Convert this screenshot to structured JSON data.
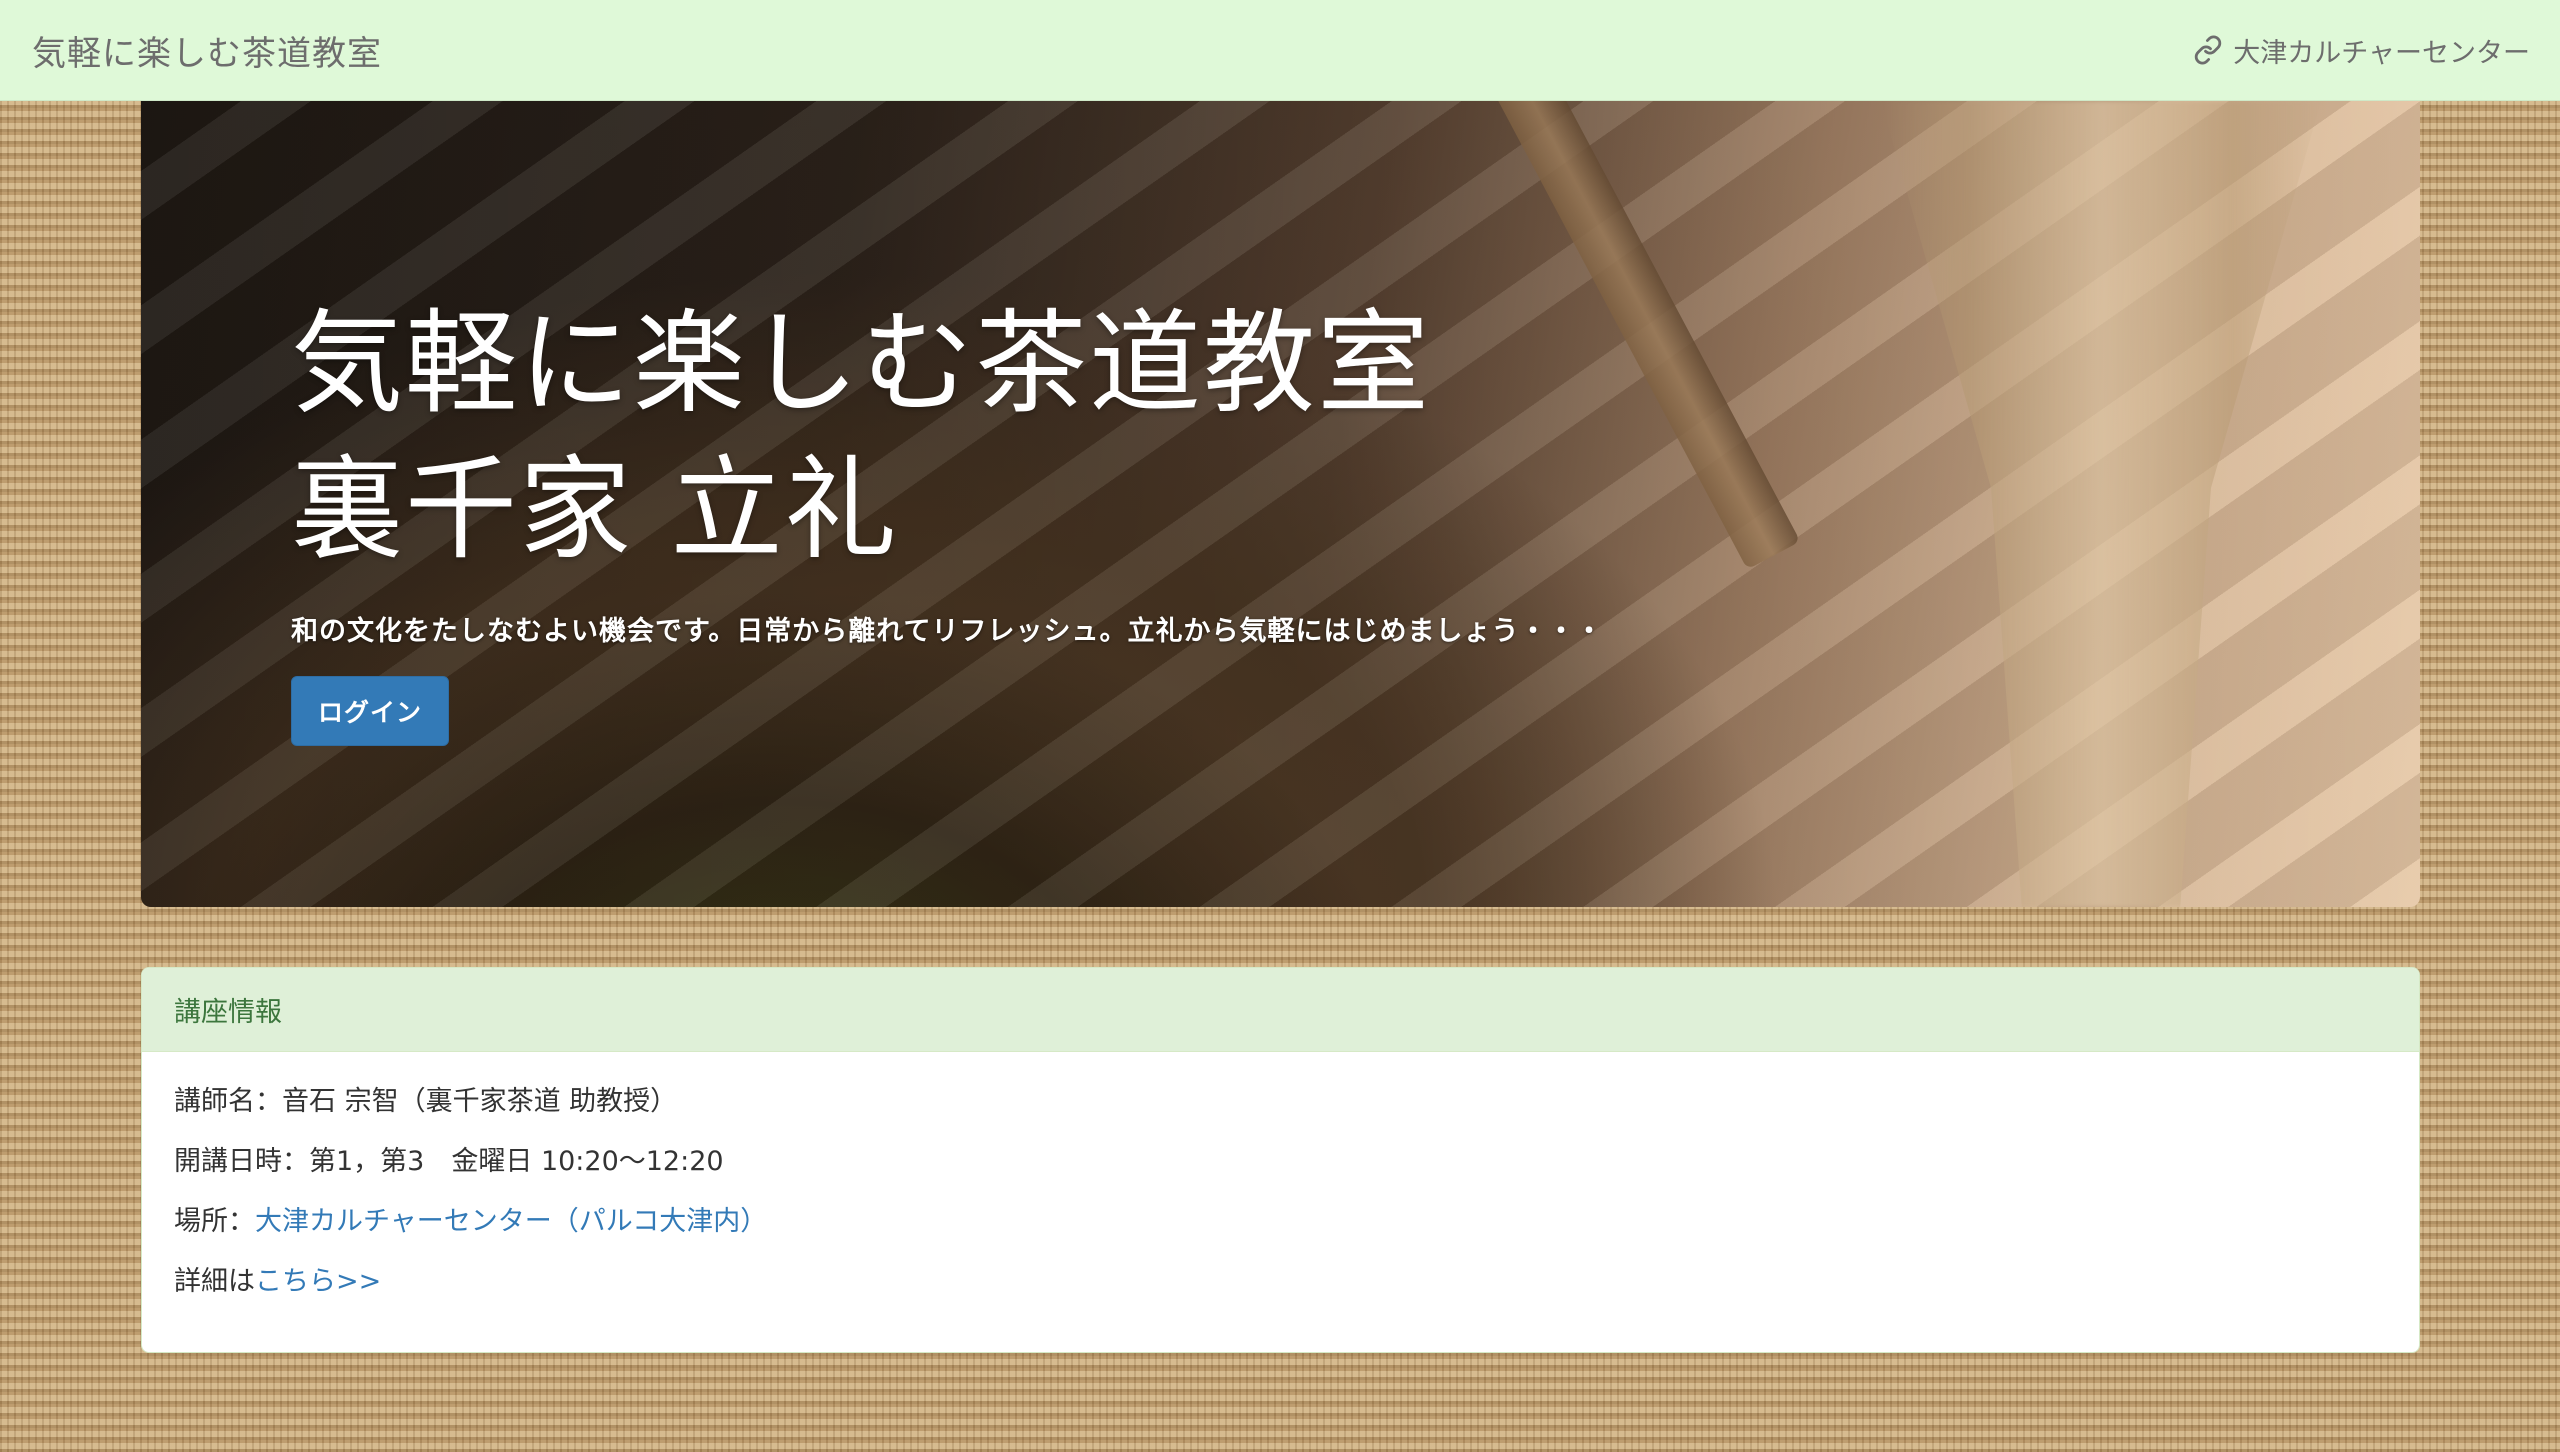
{
  "navbar": {
    "brand": "気軽に楽しむ茶道教室",
    "link_label": "大津カルチャーセンター",
    "link_icon": "link-icon"
  },
  "hero": {
    "title_line1": "気軽に楽しむ茶道教室",
    "title_line2": "裏千家 立礼",
    "lead": "和の文化をたしなむよい機会です。日常から離れてリフレッシュ。立礼から気軽にはじめましょう・・・",
    "login_label": "ログイン"
  },
  "panel": {
    "heading": "講座情報",
    "instructor": "講師名：音石 宗智（裏千家茶道 助教授）",
    "schedule": "開講日時：第1，第3　金曜日 10:20〜12:20",
    "place_label": "場所：",
    "place_link": "大津カルチャーセンター（パルコ大津内）",
    "detail_label": "詳細は",
    "detail_link": "こちら>>"
  },
  "colors": {
    "navbar_bg": "#dff9d8",
    "primary": "#337ab7",
    "panel_heading_bg": "#dff0d8",
    "panel_heading_text": "#3c763d"
  }
}
